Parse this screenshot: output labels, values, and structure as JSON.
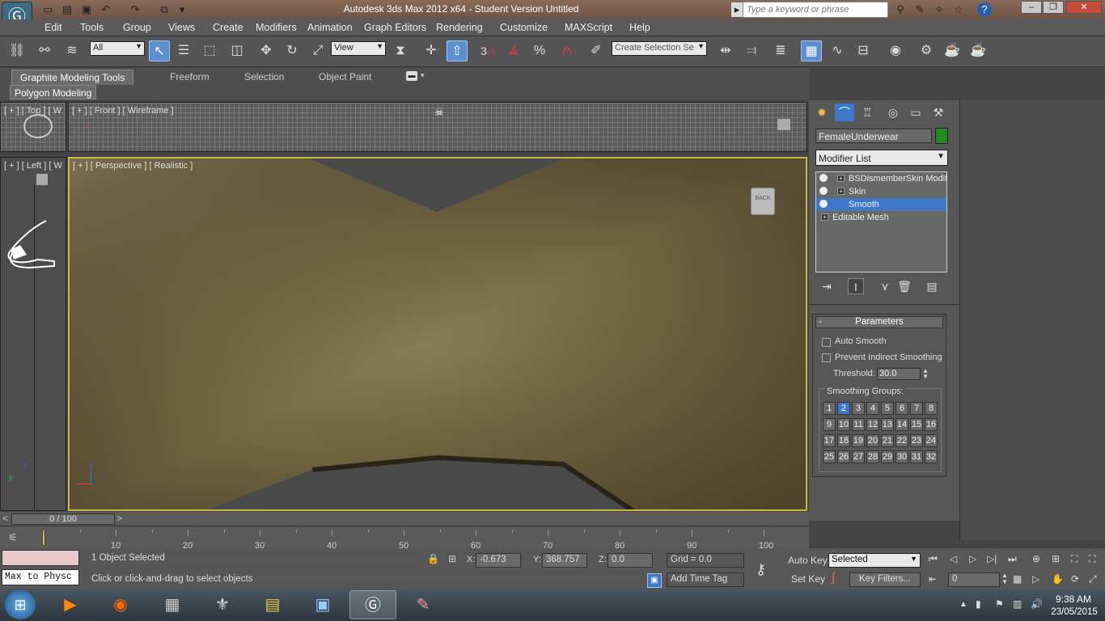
{
  "titlebar": {
    "title": "Autodesk 3ds Max  2012 x64   - Student Version    Untitled",
    "search_placeholder": "Type a keyword or phrase"
  },
  "menubar": [
    "Edit",
    "Tools",
    "Group",
    "Views",
    "Create",
    "Modifiers",
    "Animation",
    "Graph Editors",
    "Rendering",
    "Customize",
    "MAXScript",
    "Help"
  ],
  "toolbar": {
    "selection_filter": "All",
    "ref_coord": "View",
    "snap_label": "3",
    "named_sel": "Create Selection Se"
  },
  "ribbon": {
    "tabs": [
      "Graphite Modeling Tools",
      "Freeform",
      "Selection",
      "Object Paint"
    ],
    "panel": "Polygon Modeling"
  },
  "viewports": {
    "top": "[ + ] [ Top ] [ W",
    "front": "[ + ] [ Front ] [ Wireframe ]",
    "left": "[ + ] [ Left ] [ W",
    "perspective": "[ + ] [ Perspective ] [ Realistic ]",
    "viewcube_label": "BACK"
  },
  "command_panel": {
    "object_name": "FemaleUnderwear",
    "object_color": "#1e8c1e",
    "modifier_list": "Modifier List",
    "stack": [
      {
        "label": "BSDismemberSkin Modifier",
        "selected": false
      },
      {
        "label": "Skin",
        "selected": false
      },
      {
        "label": "Smooth",
        "selected": true
      },
      {
        "label": "Editable Mesh",
        "selected": false
      }
    ],
    "params": {
      "header": "Parameters",
      "auto_smooth": "Auto Smooth",
      "prevent": "Prevent Indirect Smoothing",
      "threshold_label": "Threshold:",
      "threshold_value": "30.0",
      "groups_label": "Smoothing Groups:",
      "groups": [
        "1",
        "2",
        "3",
        "4",
        "5",
        "6",
        "7",
        "8",
        "9",
        "10",
        "11",
        "12",
        "13",
        "14",
        "15",
        "16",
        "17",
        "18",
        "19",
        "20",
        "21",
        "22",
        "23",
        "24",
        "25",
        "26",
        "27",
        "28",
        "29",
        "30",
        "31",
        "32"
      ],
      "active_group": "2"
    }
  },
  "timeline": {
    "frame": "0 / 100",
    "ticks": [
      "10",
      "20",
      "30",
      "40",
      "50",
      "60",
      "70",
      "80",
      "90",
      "100"
    ]
  },
  "status": {
    "selected": "1 Object Selected",
    "prompt": "Click or click-and-drag to select objects",
    "maxscript": "Max to Physc",
    "x_label": "X:",
    "x": "-0.673",
    "y_label": "Y:",
    "y": "368.757",
    "z_label": "Z:",
    "z": "0.0",
    "grid": "Grid = 0.0",
    "add_time_tag": "Add Time Tag",
    "auto_key": "Auto Key",
    "set_key": "Set Key",
    "key_mode": "Selected",
    "key_filters": "Key Filters...",
    "current_frame": "0"
  },
  "clock": {
    "time": "9:38 AM",
    "date": "23/05/2015"
  }
}
